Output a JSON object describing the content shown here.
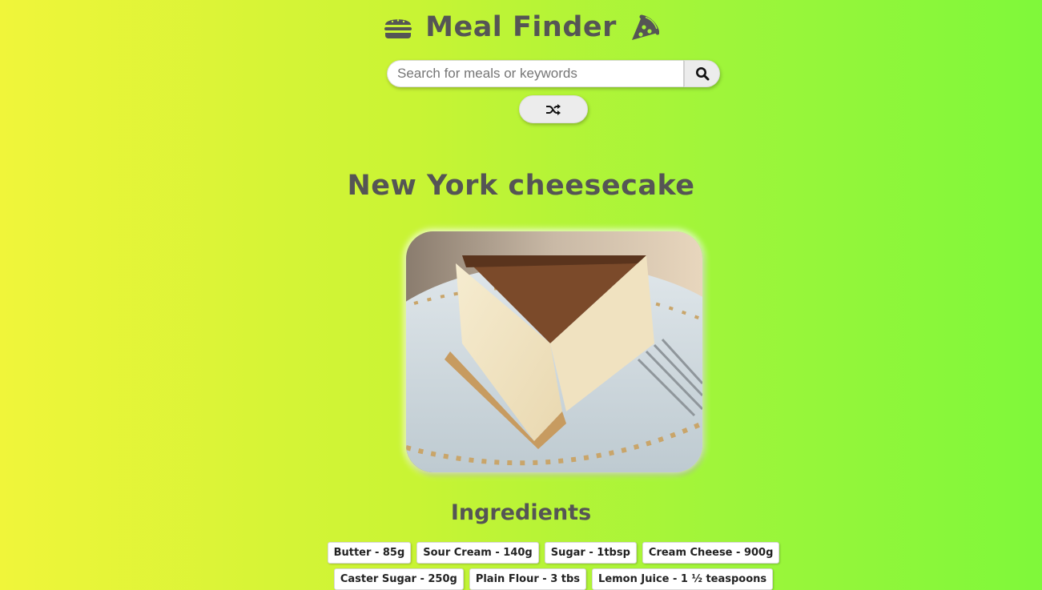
{
  "header": {
    "title": "Meal Finder",
    "left_icon": "burger-icon",
    "right_icon": "pizza-icon"
  },
  "search": {
    "placeholder": "Search for meals or keywords",
    "value": "",
    "button_icon": "search-icon"
  },
  "random": {
    "button_icon": "shuffle-icon"
  },
  "meal": {
    "title": "New York cheesecake",
    "image_subject": "cheesecake slice on plate",
    "ingredients_heading": "Ingredients",
    "ingredients": [
      "Butter - 85g",
      "Sour Cream - 140g",
      "Sugar - 1tbsp",
      "Cream Cheese - 900g",
      "Caster Sugar - 250g",
      "Plain Flour - 3 tbs",
      "Lemon Juice - 1 ½ teaspoons"
    ]
  },
  "colors": {
    "background_start": "#f0f53a",
    "background_end": "#7ff83a",
    "text": "#555555"
  }
}
